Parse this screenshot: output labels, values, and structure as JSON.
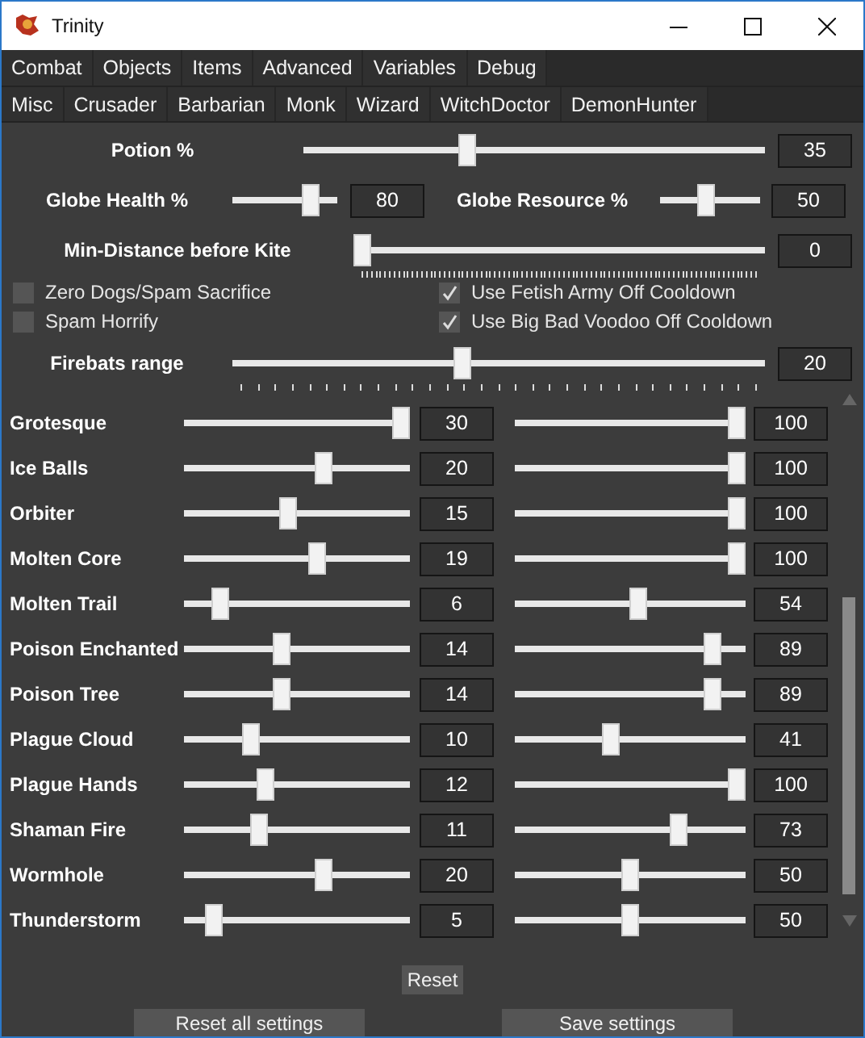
{
  "window": {
    "title": "Trinity"
  },
  "tabs": [
    {
      "label": "Combat"
    },
    {
      "label": "Objects"
    },
    {
      "label": "Items"
    },
    {
      "label": "Advanced"
    },
    {
      "label": "Variables"
    },
    {
      "label": "Debug"
    }
  ],
  "subtabs": [
    {
      "label": "Misc"
    },
    {
      "label": "Crusader"
    },
    {
      "label": "Barbarian"
    },
    {
      "label": "Monk"
    },
    {
      "label": "Wizard"
    },
    {
      "label": "WitchDoctor"
    },
    {
      "label": "DemonHunter"
    }
  ],
  "potion": {
    "label": "Potion %",
    "level": 0.35,
    "value": "35"
  },
  "globe_health": {
    "label": "Globe Health %",
    "level": 0.8,
    "value": "80"
  },
  "globe_resource": {
    "label": "Globe Resource %",
    "level": 0.45,
    "value": "50"
  },
  "min_distance": {
    "label": "Min-Distance before Kite",
    "level": 0,
    "value": "0"
  },
  "checkboxes": [
    {
      "label": "Zero Dogs/Spam Sacrifice",
      "checked": false
    },
    {
      "label": "Use Fetish Army Off Cooldown",
      "checked": true
    },
    {
      "label": "Spam Horrify",
      "checked": false
    },
    {
      "label": "Use Big Bad Voodoo Off Cooldown",
      "checked": true
    }
  ],
  "firebats": {
    "label": "Firebats range",
    "level": 0.43,
    "value": "20"
  },
  "skills": [
    {
      "name": "Grotesque",
      "first": {
        "level": 1,
        "value": "30"
      },
      "second": {
        "level": 1,
        "value": "100"
      }
    },
    {
      "name": "Ice Balls",
      "first": {
        "level": 0.63,
        "value": "20"
      },
      "second": {
        "level": 1,
        "value": "100"
      }
    },
    {
      "name": "Orbiter",
      "first": {
        "level": 0.46,
        "value": "15"
      },
      "second": {
        "level": 1,
        "value": "100"
      }
    },
    {
      "name": "Molten Core",
      "first": {
        "level": 0.6,
        "value": "19"
      },
      "second": {
        "level": 1,
        "value": "100"
      }
    },
    {
      "name": "Molten Trail",
      "first": {
        "level": 0.13,
        "value": "6"
      },
      "second": {
        "level": 0.54,
        "value": "54"
      }
    },
    {
      "name": "Poison Enchanted",
      "first": {
        "level": 0.43,
        "value": "14"
      },
      "second": {
        "level": 0.89,
        "value": "89"
      }
    },
    {
      "name": "Poison Tree",
      "first": {
        "level": 0.43,
        "value": "14"
      },
      "second": {
        "level": 0.89,
        "value": "89"
      }
    },
    {
      "name": "Plague Cloud",
      "first": {
        "level": 0.28,
        "value": "10"
      },
      "second": {
        "level": 0.41,
        "value": "41"
      }
    },
    {
      "name": "Plague Hands",
      "first": {
        "level": 0.35,
        "value": "12"
      },
      "second": {
        "level": 1,
        "value": "100"
      }
    },
    {
      "name": "Shaman Fire",
      "first": {
        "level": 0.32,
        "value": "11"
      },
      "second": {
        "level": 0.73,
        "value": "73"
      }
    },
    {
      "name": "Wormhole",
      "first": {
        "level": 0.63,
        "value": "20"
      },
      "second": {
        "level": 0.5,
        "value": "50"
      }
    },
    {
      "name": "Thunderstorm",
      "first": {
        "level": 0.1,
        "value": "5"
      },
      "second": {
        "level": 0.5,
        "value": "50"
      }
    }
  ],
  "reset_button": "Reset",
  "buttons": [
    "Reset all settings",
    "Save settings"
  ]
}
